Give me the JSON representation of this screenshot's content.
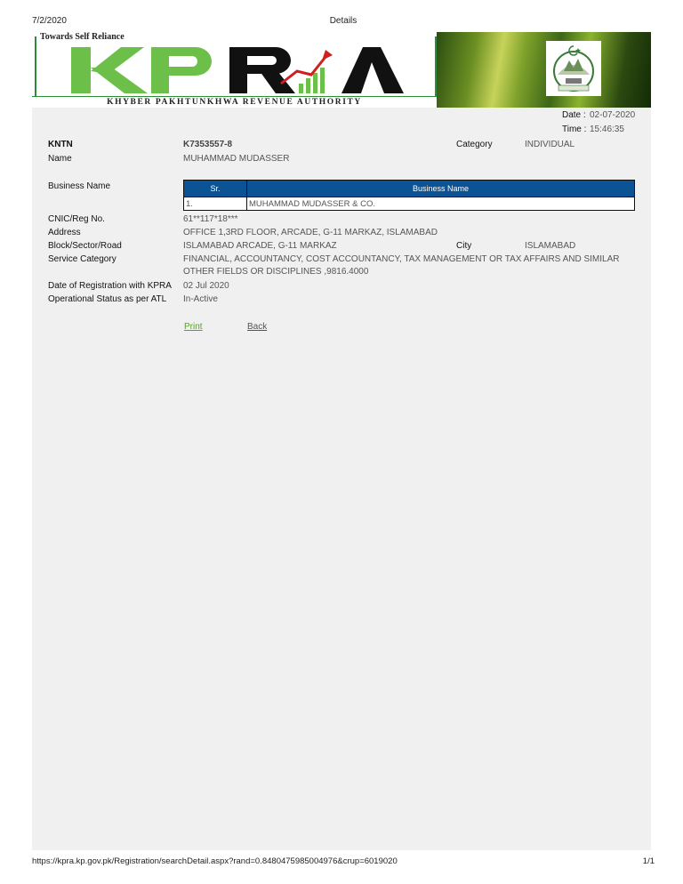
{
  "print_header": {
    "date": "7/2/2020",
    "title": "Details"
  },
  "print_footer": {
    "url": "https://kpra.kp.gov.pk/Registration/searchDetail.aspx?rand=0.8480475985004976&crup=6019020",
    "page": "1/1"
  },
  "banner": {
    "tagline": "Towards Self Reliance",
    "logo_text": "KPRA",
    "authority": "KHYBER PAKHTUNKHWA REVENUE AUTHORITY",
    "colors": {
      "green": "#6cc04a",
      "black": "#111111",
      "arrow": "#d11f1f"
    }
  },
  "meta": {
    "date_label": "Date :",
    "date_value": "02-07-2020",
    "time_label": "Time :",
    "time_value": "15:46:35"
  },
  "details": {
    "kntn_label": "KNTN",
    "kntn_value": "K7353557-8",
    "category_label": "Category",
    "category_value": "INDIVIDUAL",
    "name_label": "Name",
    "name_value": "MUHAMMAD MUDASSER",
    "business_name_label": "Business Name",
    "cnic_label": "CNIC/Reg No.",
    "cnic_value": "61**117*18***",
    "address_label": "Address",
    "address_value": "OFFICE 1,3RD FLOOR, ARCADE, G-11 MARKAZ, ISLAMABAD",
    "block_label": "Block/Sector/Road",
    "block_value": "ISLAMABAD ARCADE, G-11 MARKAZ",
    "city_label": "City",
    "city_value": "ISLAMABAD",
    "service_label": "Service Category",
    "service_value_1": "FINANCIAL, ACCOUNTANCY, COST ACCOUNTANCY, TAX MANAGEMENT OR TAX AFFAIRS AND SIMILAR",
    "service_value_2": "OTHER FIELDS OR DISCIPLINES ,9816.4000",
    "reg_date_label": "Date of Registration with KPRA",
    "reg_date_value": "02 Jul 2020",
    "status_label": "Operational Status as per ATL",
    "status_value": "In-Active"
  },
  "business_table": {
    "headers": [
      "Sr.",
      "Business Name"
    ],
    "rows": [
      [
        "1.",
        "MUHAMMAD MUDASSER & CO."
      ]
    ]
  },
  "actions": {
    "print": "Print",
    "back": "Back"
  }
}
